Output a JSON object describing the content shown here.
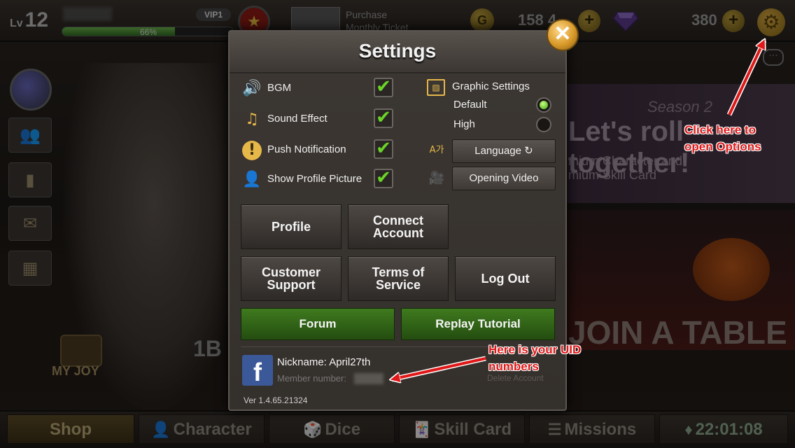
{
  "player": {
    "level_prefix": "Lv",
    "level": "12",
    "vip": "VIP1",
    "xp_percent": "66%",
    "xp_fraction": 0.66
  },
  "purchase": {
    "line1": "Purchase",
    "line2": "Monthly Ticket"
  },
  "currency": {
    "coin_symbol": "G",
    "gold": "158 4",
    "gems": "380",
    "plus": "+"
  },
  "banner": {
    "season": "Season 2",
    "title": "Let's roll together!",
    "sub1": "mium Character and",
    "sub2": "mium Skill Card",
    "join": "JOIN A TABLE",
    "chips": "1B",
    "myjoy": "MY JOY"
  },
  "bottom_tabs": [
    {
      "label": "Shop",
      "icon": ""
    },
    {
      "label": "Character",
      "icon": "👤"
    },
    {
      "label": "Dice",
      "icon": "🎲"
    },
    {
      "label": "Skill Card",
      "icon": "🃏"
    },
    {
      "label": "Missions",
      "icon": "☰"
    },
    {
      "label": "22:01:08",
      "icon": "♦"
    }
  ],
  "settings": {
    "title": "Settings",
    "close": "✕",
    "options": [
      {
        "label": "BGM",
        "icon": "🔊",
        "checked": true
      },
      {
        "label": "Sound Effect",
        "icon": "♫",
        "checked": true
      },
      {
        "label": "Push Notification",
        "icon": "!",
        "checked": true
      },
      {
        "label": "Show Profile Picture",
        "icon": "👤",
        "checked": true
      }
    ],
    "check_glyph": "✔",
    "graphic": {
      "title": "Graphic Settings",
      "icon": "▨",
      "default_label": "Default",
      "high_label": "High",
      "selected": "Default"
    },
    "language_icon": "A가",
    "language_label": "Language ↻",
    "video_icon": "🎥",
    "opening_video_label": "Opening Video",
    "buttons": {
      "profile": "Profile",
      "connect_account": "Connect Account",
      "customer_support": "Customer Support",
      "terms_of_service": "Terms of Service",
      "log_out": "Log Out",
      "forum": "Forum",
      "replay_tutorial": "Replay Tutorial"
    },
    "account": {
      "fb_letter": "f",
      "nickname": "Nickname: April27th",
      "member_number": "Member number:",
      "delete_account": "Delete Account"
    },
    "version": "Ver 1.4.65.21324"
  },
  "annotations": {
    "options_line1": "Click here to",
    "options_line2": "open Options",
    "uid_line1": "Here is your UID",
    "uid_line2": "numbers"
  },
  "colors": {
    "accent_red": "#e01818",
    "check_green": "#6ad428",
    "gold": "#d99a2a",
    "facebook": "#3b5998"
  }
}
